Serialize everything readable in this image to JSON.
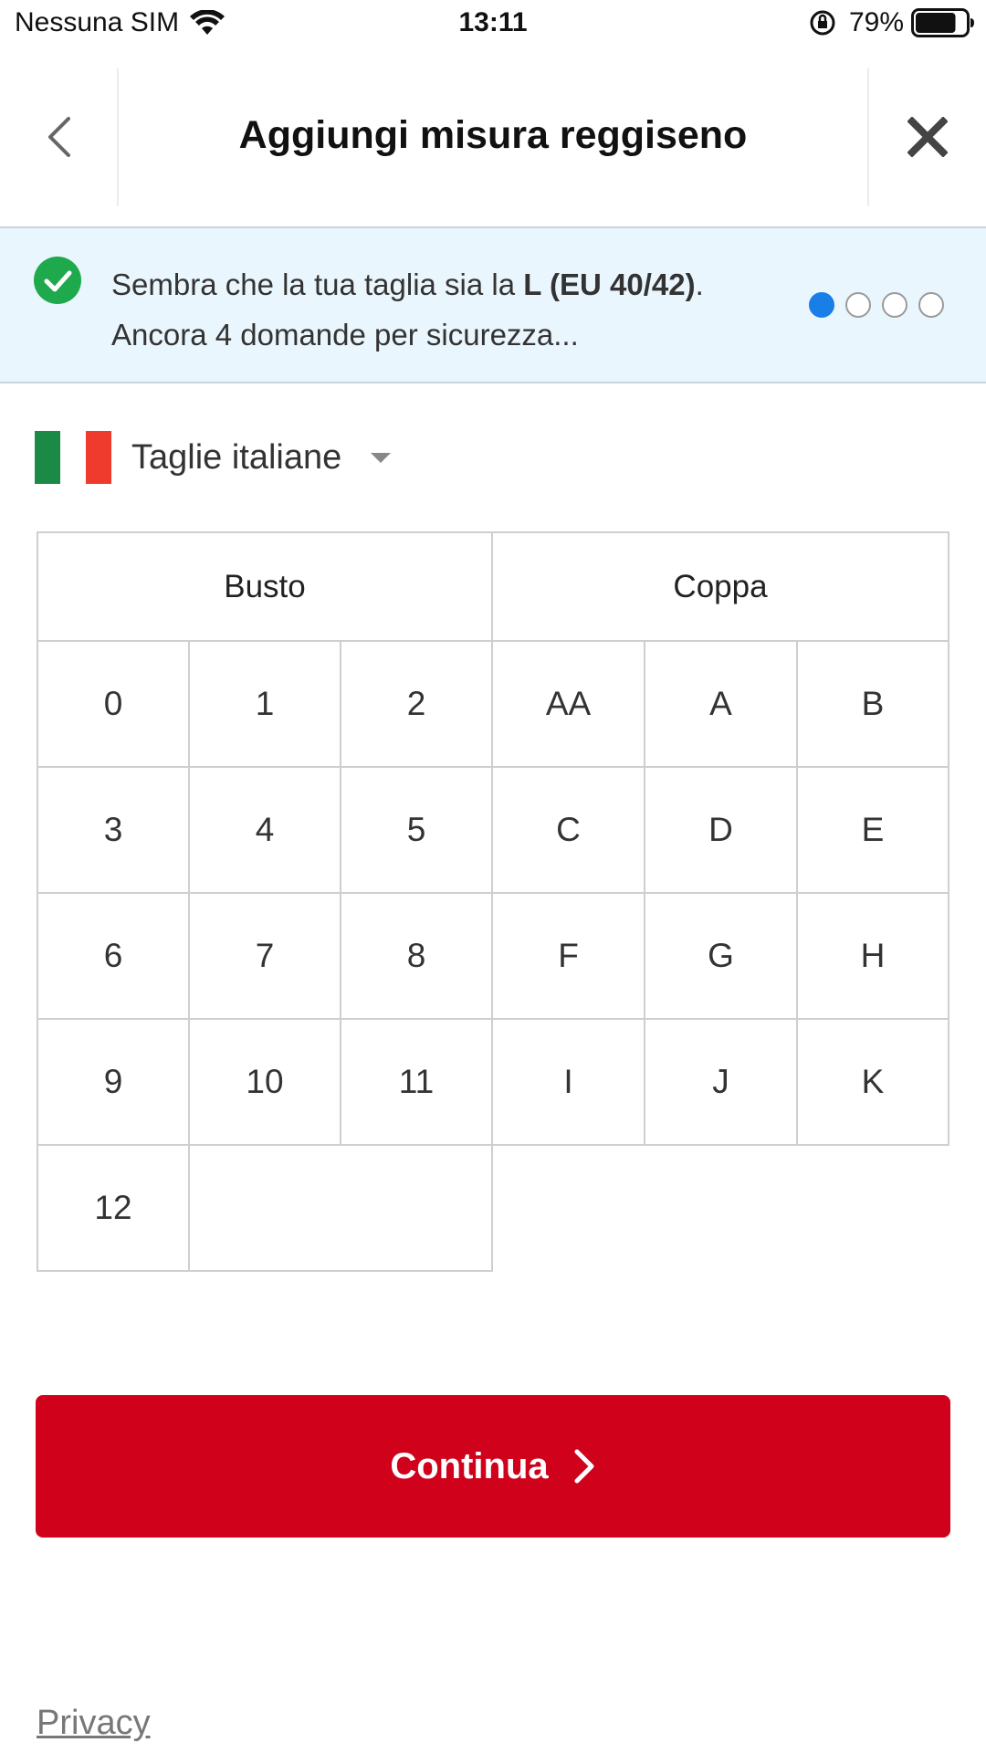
{
  "status_bar": {
    "carrier": "Nessuna SIM",
    "time": "13:11",
    "battery_percent": "79%",
    "battery_level": 0.79,
    "icons": [
      "wifi-icon",
      "rotation-lock-icon",
      "battery-icon"
    ]
  },
  "header": {
    "title": "Aggiungi misura reggiseno",
    "back_icon": "chevron-left-icon",
    "close_icon": "close-icon"
  },
  "banner": {
    "text_before": "Sembra che la tua taglia sia la ",
    "size_highlight": "L (EU 40/42)",
    "text_after": ".",
    "line2": "Ancora 4 domande per sicurezza...",
    "icon": "check-circle-icon",
    "steps_total": 4,
    "step_current": 1,
    "colors": {
      "background": "#eaf6fd",
      "check": "#1ea94c",
      "active_dot": "#1a7ee8"
    }
  },
  "size_system": {
    "label": "Taglie italiane",
    "flag_colors": [
      "#1a8a46",
      "#ffffff",
      "#ee3b2e"
    ]
  },
  "grid": {
    "busto_header": "Busto",
    "coppa_header": "Coppa",
    "busto": [
      "0",
      "1",
      "2",
      "3",
      "4",
      "5",
      "6",
      "7",
      "8",
      "9",
      "10",
      "11",
      "12"
    ],
    "coppa": [
      "AA",
      "A",
      "B",
      "C",
      "D",
      "E",
      "F",
      "G",
      "H",
      "I",
      "J",
      "K"
    ]
  },
  "continue_button": {
    "label": "Continua",
    "color": "#d0021b"
  },
  "footer": {
    "privacy": "Privacy"
  }
}
